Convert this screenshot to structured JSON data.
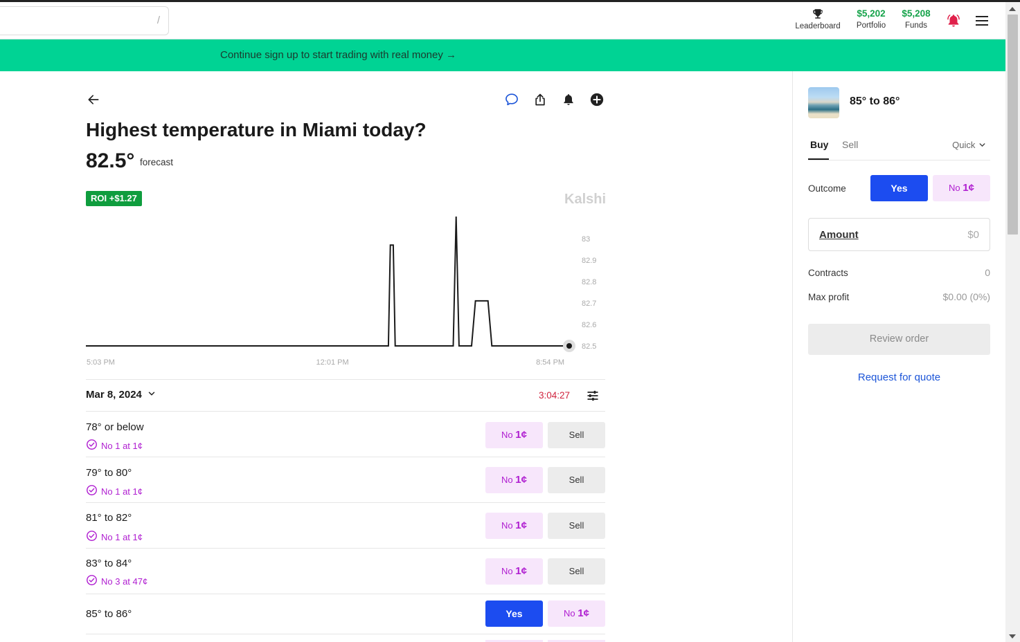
{
  "search": {
    "shortcut": "/"
  },
  "header": {
    "leaderboard_label": "Leaderboard",
    "portfolio_value": "$5,202",
    "portfolio_label": "Portfolio",
    "funds_value": "$5,208",
    "funds_label": "Funds"
  },
  "banner": {
    "text": "Continue sign up to start trading with real money →"
  },
  "market": {
    "title": "Highest temperature in Miami today?",
    "forecast_value": "82.5°",
    "forecast_label": "forecast",
    "roi_badge": "ROI +$1.27",
    "watermark": "Kalshi",
    "date": "Mar 8, 2024",
    "countdown": "3:04:27"
  },
  "chart_data": {
    "type": "line",
    "x_ticks": [
      "5:03 PM",
      "12:01 PM",
      "8:54 PM"
    ],
    "y_ticks": [
      83,
      82.9,
      82.8,
      82.7,
      82.6,
      82.5
    ],
    "ylim": [
      82.5,
      83.05
    ],
    "series": [
      {
        "values": [
          {
            "x": 0.0,
            "y": 82.5
          },
          {
            "x": 0.626,
            "y": 82.5
          },
          {
            "x": 0.63,
            "y": 82.97
          },
          {
            "x": 0.636,
            "y": 82.97
          },
          {
            "x": 0.64,
            "y": 82.5
          },
          {
            "x": 0.76,
            "y": 82.5
          },
          {
            "x": 0.766,
            "y": 83.12
          },
          {
            "x": 0.772,
            "y": 82.5
          },
          {
            "x": 0.798,
            "y": 82.5
          },
          {
            "x": 0.806,
            "y": 82.71
          },
          {
            "x": 0.832,
            "y": 82.71
          },
          {
            "x": 0.84,
            "y": 82.5
          },
          {
            "x": 1.0,
            "y": 82.5
          }
        ]
      }
    ]
  },
  "outcomes": [
    {
      "range": "78° or below",
      "position": "No 1 at 1¢",
      "btn1_type": "no",
      "btn1_prefix": "No",
      "btn1_price": "1¢",
      "btn2_label": "Sell"
    },
    {
      "range": "79° to 80°",
      "position": "No 1 at 1¢",
      "btn1_type": "no",
      "btn1_prefix": "No",
      "btn1_price": "1¢",
      "btn2_label": "Sell"
    },
    {
      "range": "81° to 82°",
      "position": "No 1 at 1¢",
      "btn1_type": "no",
      "btn1_prefix": "No",
      "btn1_price": "1¢",
      "btn2_label": "Sell"
    },
    {
      "range": "83° to 84°",
      "position": "No 3 at 47¢",
      "btn1_type": "no",
      "btn1_prefix": "No",
      "btn1_price": "1¢",
      "btn2_label": "Sell"
    },
    {
      "range": "85° to 86°",
      "position": "",
      "btn1_type": "yes",
      "btn1_label": "Yes",
      "btn2_prefix": "No",
      "btn2_price": "1¢"
    }
  ],
  "order_panel": {
    "title": "85° to 86°",
    "tab_buy": "Buy",
    "tab_sell": "Sell",
    "mode": "Quick",
    "outcome_label": "Outcome",
    "yes_label": "Yes",
    "no_prefix": "No",
    "no_price": "1¢",
    "amount_label": "Amount",
    "amount_value": "$0",
    "contracts_label": "Contracts",
    "contracts_value": "0",
    "max_profit_label": "Max profit",
    "max_profit_value": "$0.00 (0%)",
    "review_label": "Review order",
    "quote_label": "Request for quote"
  },
  "colors": {
    "accent_green": "#00d394",
    "yes_blue": "#1c4cf0",
    "no_purple": "#b01fd1",
    "profit_green": "#15a34a",
    "timer_red": "#d0223d"
  }
}
